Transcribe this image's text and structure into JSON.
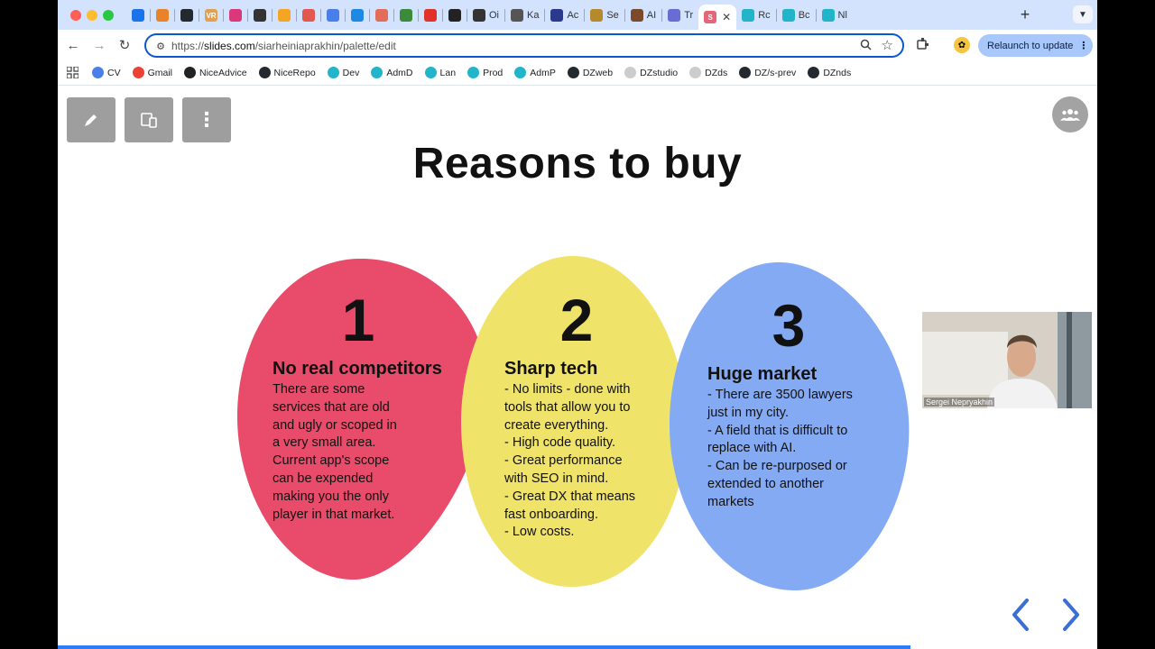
{
  "browser": {
    "tabs": [
      {
        "label": "",
        "icon": "chrome-icon",
        "color": "#1a73e8"
      },
      {
        "label": "",
        "icon": "package-icon",
        "color": "#e8832a"
      },
      {
        "label": "",
        "icon": "github-icon",
        "color": "#24292f"
      },
      {
        "label": "",
        "icon": "vr-icon",
        "color": "#e0a050",
        "glyph": "VR"
      },
      {
        "label": "",
        "icon": "pinwheel-icon",
        "color": "#d9387a"
      },
      {
        "label": "",
        "icon": "openai-icon",
        "color": "#333333"
      },
      {
        "label": "",
        "icon": "analytics-icon",
        "color": "#f4a523"
      },
      {
        "label": "",
        "icon": "figma-icon",
        "color": "#e2584f"
      },
      {
        "label": "",
        "icon": "docs-icon",
        "color": "#4a7ee8"
      },
      {
        "label": "",
        "icon": "butterfly-icon",
        "color": "#1e88e5"
      },
      {
        "label": "",
        "icon": "swirl-icon",
        "color": "#e26d5a"
      },
      {
        "label": "",
        "icon": "globe-icon",
        "color": "#3b8b3b"
      },
      {
        "label": "",
        "icon": "adobe-icon",
        "color": "#e0322a"
      },
      {
        "label": "",
        "icon": "cube-icon",
        "color": "#222222"
      },
      {
        "label": "Oi",
        "icon": "openai-icon",
        "color": "#333333"
      },
      {
        "label": "Ka",
        "icon": "gear-icon",
        "color": "#555555"
      },
      {
        "label": "Ac",
        "icon": "triangle-icon",
        "color": "#2b3a8c"
      },
      {
        "label": "Se",
        "icon": "compass-icon",
        "color": "#b48a2a"
      },
      {
        "label": "AI",
        "icon": "photo-icon",
        "color": "#7a4a2a"
      },
      {
        "label": "Tr",
        "icon": "translate-icon",
        "color": "#6b6bd6"
      },
      {
        "label": "",
        "icon": "slides-icon",
        "color": "#e5667b",
        "glyph": "S",
        "active": true
      },
      {
        "label": "Rc",
        "icon": "face-icon",
        "color": "#22b5c9"
      },
      {
        "label": "Bc",
        "icon": "face-icon",
        "color": "#22b5c9"
      },
      {
        "label": "Nl",
        "icon": "face-icon",
        "color": "#22b5c9"
      }
    ],
    "new_tab": "+",
    "url_prefix": "https://",
    "url_host": "slides.com",
    "url_path": "/siarheiniaprakhin/palette/edit",
    "relaunch_label": "Relaunch to update",
    "bookmarks": [
      {
        "label": "CV",
        "icon": "doc-icon",
        "color": "#4a7ee8"
      },
      {
        "label": "Gmail",
        "icon": "gmail-icon",
        "color": "#ea4335"
      },
      {
        "label": "NiceAdvice",
        "icon": "triangle-icon",
        "color": "#222222"
      },
      {
        "label": "NiceRepo",
        "icon": "github-icon",
        "color": "#24292f"
      },
      {
        "label": "Dev",
        "icon": "face-icon",
        "color": "#22b5c9"
      },
      {
        "label": "AdmD",
        "icon": "face-icon",
        "color": "#22b5c9"
      },
      {
        "label": "Lan",
        "icon": "face-icon",
        "color": "#22b5c9"
      },
      {
        "label": "Prod",
        "icon": "face-icon",
        "color": "#22b5c9"
      },
      {
        "label": "AdmP",
        "icon": "face-icon",
        "color": "#22b5c9"
      },
      {
        "label": "DZweb",
        "icon": "github-icon",
        "color": "#24292f"
      },
      {
        "label": "DZstudio",
        "icon": "globe-icon",
        "color": "#cccccc"
      },
      {
        "label": "DZds",
        "icon": "globe-icon",
        "color": "#cccccc"
      },
      {
        "label": "DZ/s-prev",
        "icon": "github-icon",
        "color": "#24292f"
      },
      {
        "label": "DZnds",
        "icon": "github-icon",
        "color": "#24292f"
      }
    ]
  },
  "slide": {
    "title": "Reasons to buy",
    "cards": [
      {
        "number": "1",
        "heading": "No real competitors",
        "body": "There are some\nservices that are old\nand ugly or scoped in\na very small area.\nCurrent app's scope\ncan be expended\nmaking you the only\nplayer in that market.",
        "color": "#e84c6a"
      },
      {
        "number": "2",
        "heading": "Sharp tech",
        "body": "- No limits - done with\ntools that allow you to\ncreate everything.\n- High code quality.\n- Great performance\nwith SEO in mind.\n- Great DX that means\nfast onboarding.\n- Low costs.",
        "color": "#f0e36a"
      },
      {
        "number": "3",
        "heading": "Huge market",
        "body": "- There are 3500 lawyers\njust in my city.\n- A field that is difficult to\nreplace with AI.\n- Can be re-purposed or\nextended to another\nmarkets",
        "color": "#84aaf3"
      }
    ],
    "webcam_name": "Sergei Nepryakhin",
    "progress": 0.82
  },
  "colors": {
    "tabstrip": "#d3e3fd",
    "accent": "#0b57d0",
    "arrow": "#3a6fd6",
    "tool_button": "#9e9e9e"
  }
}
